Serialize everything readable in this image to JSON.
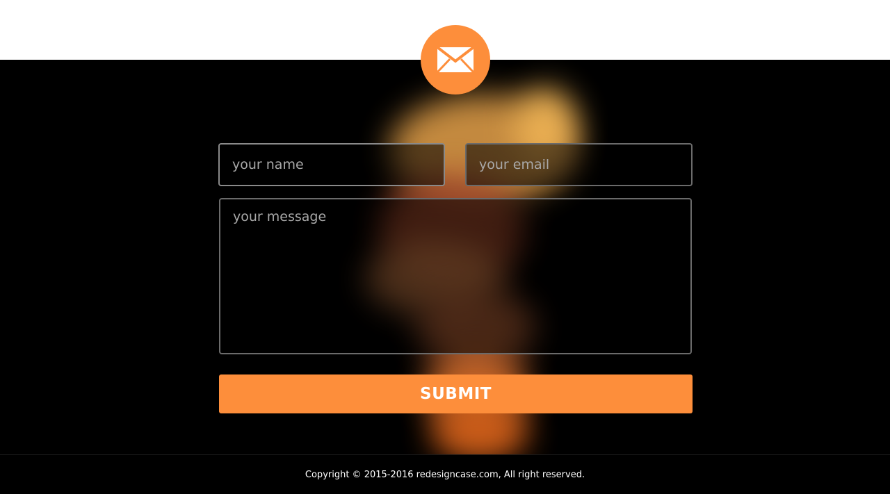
{
  "contact_form": {
    "name_placeholder": "your name",
    "email_placeholder": "your email",
    "message_placeholder": "your message",
    "submit_label": "SUBMIT"
  },
  "icons": {
    "badge": "envelope-icon"
  },
  "footer": {
    "copyright": "Copyright © 2015-2016 redesigncase.com, All right reserved."
  },
  "colors": {
    "accent": "#fd8e3b",
    "background": "#000000",
    "top_band": "#ffffff",
    "text": "#ffffff"
  }
}
